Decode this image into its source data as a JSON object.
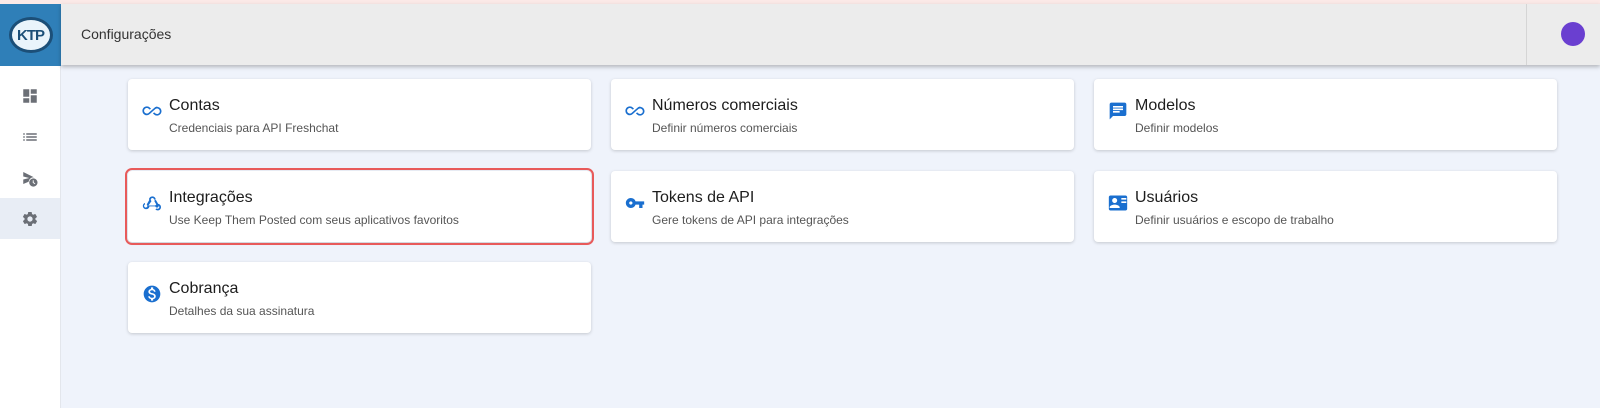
{
  "header": {
    "title": "Configurações"
  },
  "logo": {
    "text": "KTP"
  },
  "sidebar": {
    "items": [
      {
        "name": "dashboard",
        "icon": "dashboard-icon"
      },
      {
        "name": "list",
        "icon": "list-icon"
      },
      {
        "name": "scheduled",
        "icon": "scheduled-send-icon"
      },
      {
        "name": "settings",
        "icon": "gear-icon",
        "active": true
      }
    ]
  },
  "cards": [
    {
      "title": "Contas",
      "desc": "Credenciais para API Freshchat",
      "icon": "infinity-icon"
    },
    {
      "title": "Números comerciais",
      "desc": "Definir números comerciais",
      "icon": "infinity-icon"
    },
    {
      "title": "Modelos",
      "desc": "Definir modelos",
      "icon": "message-icon"
    },
    {
      "title": "Integrações",
      "desc": "Use Keep Them Posted com seus aplicativos favoritos",
      "icon": "webhook-icon",
      "highlighted": true
    },
    {
      "title": "Tokens de API",
      "desc": "Gere tokens de API para integrações",
      "icon": "key-icon"
    },
    {
      "title": "Usuários",
      "desc": "Definir usuários e escopo de trabalho",
      "icon": "contact-card-icon"
    },
    {
      "title": "Cobrança",
      "desc": "Detalhes da sua assinatura",
      "icon": "dollar-icon"
    }
  ],
  "colors": {
    "accent": "#1a6fcf",
    "highlight": "#e85a5a",
    "background": "#eff3fb"
  }
}
